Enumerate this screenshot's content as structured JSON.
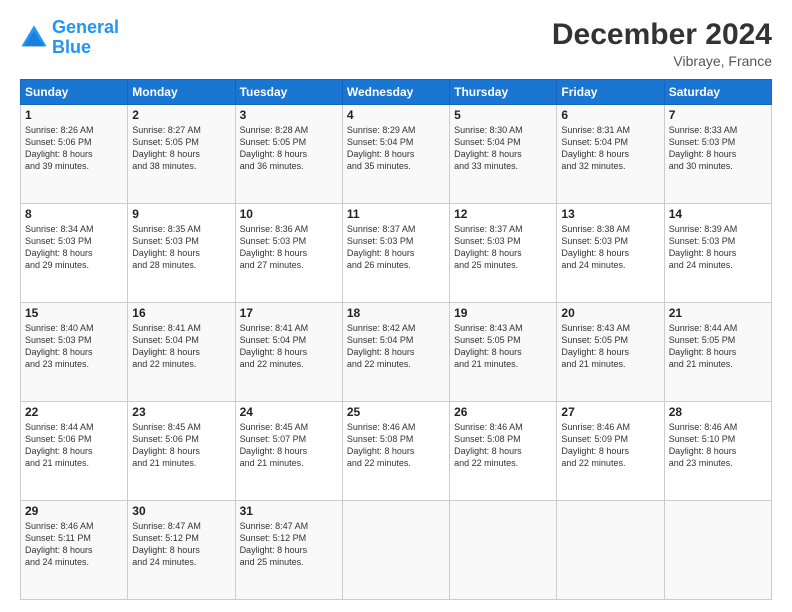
{
  "logo": {
    "line1": "General",
    "line2": "Blue"
  },
  "title": "December 2024",
  "location": "Vibraye, France",
  "days_header": [
    "Sunday",
    "Monday",
    "Tuesday",
    "Wednesday",
    "Thursday",
    "Friday",
    "Saturday"
  ],
  "weeks": [
    [
      {
        "day": "1",
        "lines": [
          "Sunrise: 8:26 AM",
          "Sunset: 5:06 PM",
          "Daylight: 8 hours",
          "and 39 minutes."
        ]
      },
      {
        "day": "2",
        "lines": [
          "Sunrise: 8:27 AM",
          "Sunset: 5:05 PM",
          "Daylight: 8 hours",
          "and 38 minutes."
        ]
      },
      {
        "day": "3",
        "lines": [
          "Sunrise: 8:28 AM",
          "Sunset: 5:05 PM",
          "Daylight: 8 hours",
          "and 36 minutes."
        ]
      },
      {
        "day": "4",
        "lines": [
          "Sunrise: 8:29 AM",
          "Sunset: 5:04 PM",
          "Daylight: 8 hours",
          "and 35 minutes."
        ]
      },
      {
        "day": "5",
        "lines": [
          "Sunrise: 8:30 AM",
          "Sunset: 5:04 PM",
          "Daylight: 8 hours",
          "and 33 minutes."
        ]
      },
      {
        "day": "6",
        "lines": [
          "Sunrise: 8:31 AM",
          "Sunset: 5:04 PM",
          "Daylight: 8 hours",
          "and 32 minutes."
        ]
      },
      {
        "day": "7",
        "lines": [
          "Sunrise: 8:33 AM",
          "Sunset: 5:03 PM",
          "Daylight: 8 hours",
          "and 30 minutes."
        ]
      }
    ],
    [
      {
        "day": "8",
        "lines": [
          "Sunrise: 8:34 AM",
          "Sunset: 5:03 PM",
          "Daylight: 8 hours",
          "and 29 minutes."
        ]
      },
      {
        "day": "9",
        "lines": [
          "Sunrise: 8:35 AM",
          "Sunset: 5:03 PM",
          "Daylight: 8 hours",
          "and 28 minutes."
        ]
      },
      {
        "day": "10",
        "lines": [
          "Sunrise: 8:36 AM",
          "Sunset: 5:03 PM",
          "Daylight: 8 hours",
          "and 27 minutes."
        ]
      },
      {
        "day": "11",
        "lines": [
          "Sunrise: 8:37 AM",
          "Sunset: 5:03 PM",
          "Daylight: 8 hours",
          "and 26 minutes."
        ]
      },
      {
        "day": "12",
        "lines": [
          "Sunrise: 8:37 AM",
          "Sunset: 5:03 PM",
          "Daylight: 8 hours",
          "and 25 minutes."
        ]
      },
      {
        "day": "13",
        "lines": [
          "Sunrise: 8:38 AM",
          "Sunset: 5:03 PM",
          "Daylight: 8 hours",
          "and 24 minutes."
        ]
      },
      {
        "day": "14",
        "lines": [
          "Sunrise: 8:39 AM",
          "Sunset: 5:03 PM",
          "Daylight: 8 hours",
          "and 24 minutes."
        ]
      }
    ],
    [
      {
        "day": "15",
        "lines": [
          "Sunrise: 8:40 AM",
          "Sunset: 5:03 PM",
          "Daylight: 8 hours",
          "and 23 minutes."
        ]
      },
      {
        "day": "16",
        "lines": [
          "Sunrise: 8:41 AM",
          "Sunset: 5:04 PM",
          "Daylight: 8 hours",
          "and 22 minutes."
        ]
      },
      {
        "day": "17",
        "lines": [
          "Sunrise: 8:41 AM",
          "Sunset: 5:04 PM",
          "Daylight: 8 hours",
          "and 22 minutes."
        ]
      },
      {
        "day": "18",
        "lines": [
          "Sunrise: 8:42 AM",
          "Sunset: 5:04 PM",
          "Daylight: 8 hours",
          "and 22 minutes."
        ]
      },
      {
        "day": "19",
        "lines": [
          "Sunrise: 8:43 AM",
          "Sunset: 5:05 PM",
          "Daylight: 8 hours",
          "and 21 minutes."
        ]
      },
      {
        "day": "20",
        "lines": [
          "Sunrise: 8:43 AM",
          "Sunset: 5:05 PM",
          "Daylight: 8 hours",
          "and 21 minutes."
        ]
      },
      {
        "day": "21",
        "lines": [
          "Sunrise: 8:44 AM",
          "Sunset: 5:05 PM",
          "Daylight: 8 hours",
          "and 21 minutes."
        ]
      }
    ],
    [
      {
        "day": "22",
        "lines": [
          "Sunrise: 8:44 AM",
          "Sunset: 5:06 PM",
          "Daylight: 8 hours",
          "and 21 minutes."
        ]
      },
      {
        "day": "23",
        "lines": [
          "Sunrise: 8:45 AM",
          "Sunset: 5:06 PM",
          "Daylight: 8 hours",
          "and 21 minutes."
        ]
      },
      {
        "day": "24",
        "lines": [
          "Sunrise: 8:45 AM",
          "Sunset: 5:07 PM",
          "Daylight: 8 hours",
          "and 21 minutes."
        ]
      },
      {
        "day": "25",
        "lines": [
          "Sunrise: 8:46 AM",
          "Sunset: 5:08 PM",
          "Daylight: 8 hours",
          "and 22 minutes."
        ]
      },
      {
        "day": "26",
        "lines": [
          "Sunrise: 8:46 AM",
          "Sunset: 5:08 PM",
          "Daylight: 8 hours",
          "and 22 minutes."
        ]
      },
      {
        "day": "27",
        "lines": [
          "Sunrise: 8:46 AM",
          "Sunset: 5:09 PM",
          "Daylight: 8 hours",
          "and 22 minutes."
        ]
      },
      {
        "day": "28",
        "lines": [
          "Sunrise: 8:46 AM",
          "Sunset: 5:10 PM",
          "Daylight: 8 hours",
          "and 23 minutes."
        ]
      }
    ],
    [
      {
        "day": "29",
        "lines": [
          "Sunrise: 8:46 AM",
          "Sunset: 5:11 PM",
          "Daylight: 8 hours",
          "and 24 minutes."
        ]
      },
      {
        "day": "30",
        "lines": [
          "Sunrise: 8:47 AM",
          "Sunset: 5:12 PM",
          "Daylight: 8 hours",
          "and 24 minutes."
        ]
      },
      {
        "day": "31",
        "lines": [
          "Sunrise: 8:47 AM",
          "Sunset: 5:12 PM",
          "Daylight: 8 hours",
          "and 25 minutes."
        ]
      },
      null,
      null,
      null,
      null
    ]
  ]
}
